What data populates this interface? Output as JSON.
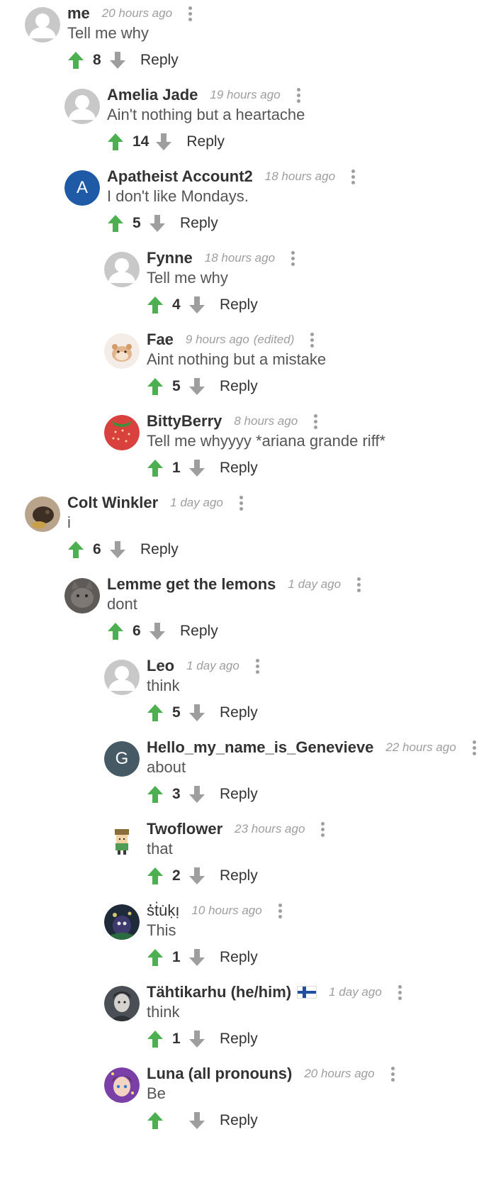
{
  "reply_label": "Reply",
  "colors": {
    "upvote": "#4caf50",
    "downvote": "#9e9e9e",
    "username": "#333333",
    "timestamp": "#9e9e9e"
  },
  "comments": [
    {
      "user": "me",
      "time": "20 hours ago",
      "text": "Tell me why",
      "votes": "8",
      "avatar": "default-avatar"
    },
    {
      "user": "Amelia Jade",
      "time": "19 hours ago",
      "text": "Ain't nothing but a heartache",
      "votes": "14",
      "avatar": "default-avatar"
    },
    {
      "user": "Apatheist Account2",
      "time": "18 hours ago",
      "text": "I don't like Mondays.",
      "votes": "5",
      "avatar": "letter-avatar",
      "letter": "A",
      "avatar_color": "#1f5aa6"
    },
    {
      "user": "Fynne",
      "time": "18 hours ago",
      "text": "Tell me why",
      "votes": "4",
      "avatar": "default-avatar"
    },
    {
      "user": "Fae",
      "time": "9 hours ago",
      "edited": "(edited)",
      "text": "Aint nothing but a mistake",
      "votes": "5",
      "avatar": "hamster-avatar"
    },
    {
      "user": "BittyBerry",
      "time": "8 hours ago",
      "text": "Tell me whyyyy *ariana grande riff*",
      "votes": "1",
      "avatar": "strawberry-avatar"
    },
    {
      "user": "Colt Winkler",
      "time": "1 day ago",
      "text": "i",
      "votes": "6",
      "avatar": "photo-avatar"
    },
    {
      "user": "Lemme get the lemons",
      "time": "1 day ago",
      "text": "dont",
      "votes": "6",
      "avatar": "cat-photo-avatar"
    },
    {
      "user": "Leo",
      "time": "1 day ago",
      "text": "think",
      "votes": "5",
      "avatar": "default-avatar"
    },
    {
      "user": "Hello_my_name_is_Genevieve",
      "time": "22 hours ago",
      "text": "about",
      "votes": "3",
      "avatar": "letter-avatar",
      "letter": "G",
      "avatar_color": "#455a64"
    },
    {
      "user": "Twoflower",
      "time": "23 hours ago",
      "text": "that",
      "votes": "2",
      "avatar": "pixel-character-avatar"
    },
    {
      "user": "ṡ̇ṫu̇ḳı̣",
      "time": "10 hours ago",
      "text": "This",
      "votes": "1",
      "avatar": "night-photo-avatar"
    },
    {
      "user": "Tähtikarhu (he/him)",
      "flag": "finland-flag",
      "time": "1 day ago",
      "text": "think",
      "votes": "1",
      "avatar": "portrait-avatar"
    },
    {
      "user": "Luna (all pronouns)",
      "time": "20 hours ago",
      "text": "Be",
      "votes": "",
      "avatar": "anime-avatar"
    }
  ]
}
